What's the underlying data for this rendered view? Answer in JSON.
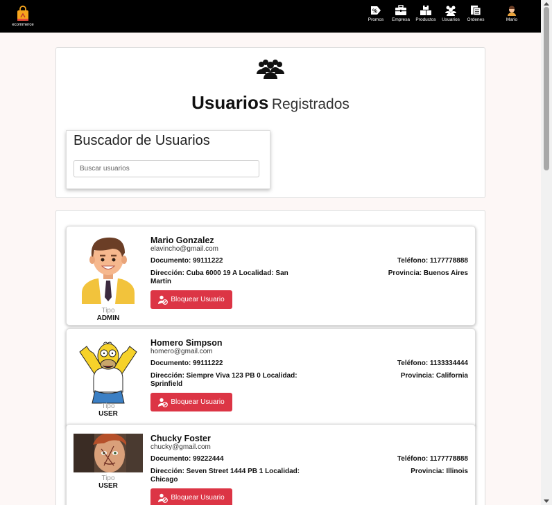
{
  "nav": {
    "brand": "ecommerce",
    "items": [
      {
        "label": "Promos",
        "icon": "percent-tag-icon"
      },
      {
        "label": "Empresa",
        "icon": "briefcase-icon"
      },
      {
        "label": "Productos",
        "icon": "boxes-icon"
      },
      {
        "label": "Usuarios",
        "icon": "users-icon"
      },
      {
        "label": "Ordenes",
        "icon": "clipboard-icon"
      },
      {
        "label": "Mario",
        "icon": "user-avatar-icon"
      }
    ]
  },
  "header": {
    "title_strong": "Usuarios",
    "title_light": "Registrados"
  },
  "search": {
    "title": "Buscador de Usuarios",
    "placeholder": "Buscar usuarios",
    "value": ""
  },
  "users": [
    {
      "name": "Mario Gonzalez",
      "email": "elavincho@gmail.com",
      "documento": "Documento: 99111222",
      "direccion": "Dirección: Cuba 6000 19 A Localidad: San Martín",
      "telefono": "Teléfono: 1177778888",
      "provincia": "Provincia: Buenos Aires",
      "tipo_label": "Tipo",
      "tipo": "ADMIN",
      "button": "Bloquear Usuario"
    },
    {
      "name": "Homero Simpson",
      "email": "homero@gmail.com",
      "documento": "Documento: 99111222",
      "direccion": "Dirección: Siempre Viva 123 PB 0 Localidad: Sprinfield",
      "telefono": "Teléfono: 1133334444",
      "provincia": "Provincia: California",
      "tipo_label": "Tipo",
      "tipo": "USER",
      "button": "Bloquear Usuario"
    },
    {
      "name": "Chucky Foster",
      "email": "chucky@gmail.com",
      "documento": "Documento: 99222444",
      "direccion": "Dirección: Seven Street 1444 PB 1 Localidad: Chicago",
      "telefono": "Teléfono: 1177778888",
      "provincia": "Provincia: Illinois",
      "tipo_label": "Tipo",
      "tipo": "USER",
      "button": "Bloquear Usuario"
    }
  ]
}
